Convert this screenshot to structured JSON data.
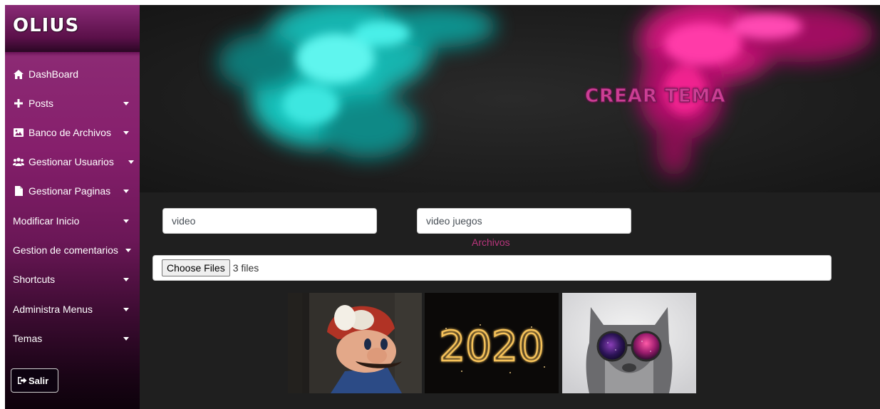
{
  "brand": {
    "name": "OLIUS"
  },
  "sidebar": {
    "items": [
      {
        "label": "DashBoard",
        "icon": "home-icon",
        "has_caret": false
      },
      {
        "label": "Posts",
        "icon": "plus-icon",
        "has_caret": true
      },
      {
        "label": "Banco de Archivos",
        "icon": "image-icon",
        "has_caret": true
      },
      {
        "label": "Gestionar Usuarios",
        "icon": "users-icon",
        "has_caret": true
      },
      {
        "label": "Gestionar Paginas",
        "icon": "file-icon",
        "has_caret": true
      },
      {
        "label": "Modificar Inicio",
        "icon": null,
        "has_caret": true
      },
      {
        "label": "Gestion de comentarios",
        "icon": null,
        "has_caret": true
      },
      {
        "label": "Shortcuts",
        "icon": null,
        "has_caret": true
      },
      {
        "label": "Administra Menus",
        "icon": null,
        "has_caret": true
      },
      {
        "label": "Temas",
        "icon": null,
        "has_caret": true
      }
    ],
    "logout_label": "Salir",
    "logout_icon": "sign-out-icon"
  },
  "hero": {
    "title": "CREAR TEMA"
  },
  "form": {
    "field_1_value": "video",
    "field_2_value": "video juegos",
    "files_label": "Archivos",
    "choose_button_label": "Choose Files",
    "files_status": "3 files"
  },
  "gallery": {
    "images": [
      {
        "name": "mario-thumbnail"
      },
      {
        "name": "sparkler-2020-thumbnail",
        "text": "2020"
      },
      {
        "name": "cat-sunglasses-thumbnail"
      }
    ]
  },
  "colors": {
    "accent": "#cc3e94",
    "sidebar": "#861f6c",
    "page_bg": "#1f1f1f"
  }
}
